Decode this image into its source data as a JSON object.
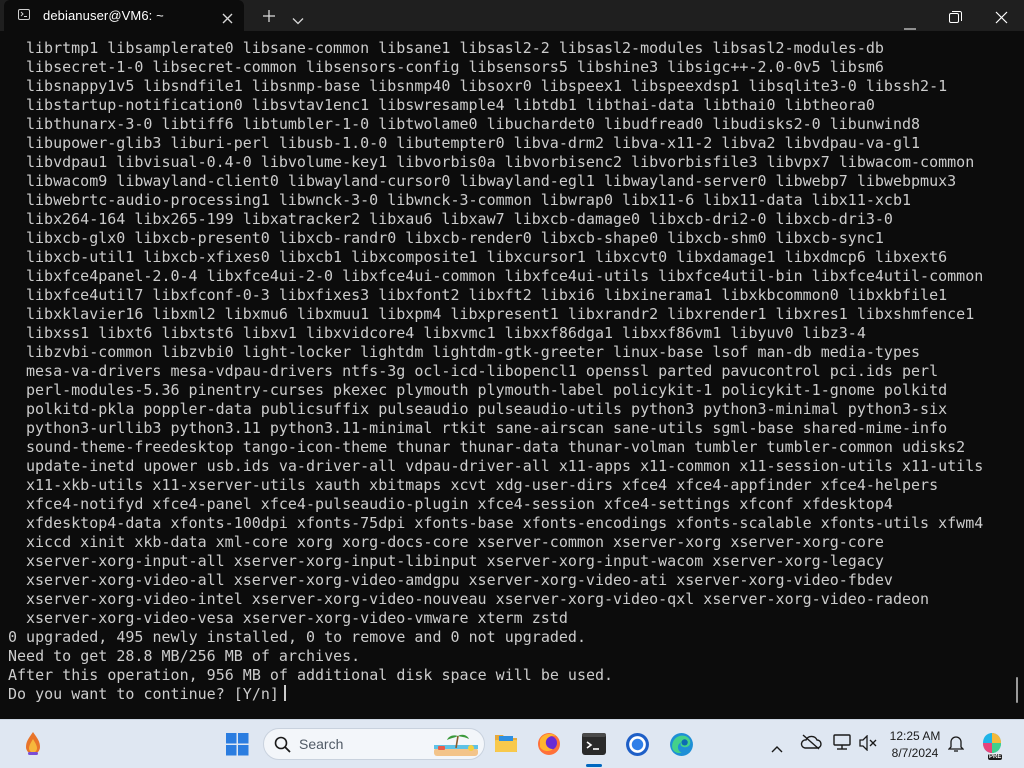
{
  "window": {
    "tab_title": "debianuser@VM6: ~",
    "tab_icon": "terminal-icon",
    "controls": [
      "close-icon",
      "plus-icon",
      "chevron-down-icon",
      "minimize-icon",
      "maximize-icon",
      "close-icon"
    ]
  },
  "terminal": {
    "package_lines": [
      "librtmp1 libsamplerate0 libsane-common libsane1 libsasl2-2 libsasl2-modules libsasl2-modules-db",
      "libsecret-1-0 libsecret-common libsensors-config libsensors5 libshine3 libsigc++-2.0-0v5 libsm6",
      "libsnappy1v5 libsndfile1 libsnmp-base libsnmp40 libsoxr0 libspeex1 libspeexdsp1 libsqlite3-0 libssh2-1",
      "libstartup-notification0 libsvtav1enc1 libswresample4 libtdb1 libthai-data libthai0 libtheora0",
      "libthunarx-3-0 libtiff6 libtumbler-1-0 libtwolame0 libuchardet0 libudfread0 libudisks2-0 libunwind8",
      "libupower-glib3 liburi-perl libusb-1.0-0 libutempter0 libva-drm2 libva-x11-2 libva2 libvdpau-va-gl1",
      "libvdpau1 libvisual-0.4-0 libvolume-key1 libvorbis0a libvorbisenc2 libvorbisfile3 libvpx7 libwacom-common",
      "libwacom9 libwayland-client0 libwayland-cursor0 libwayland-egl1 libwayland-server0 libwebp7 libwebpmux3",
      "libwebrtc-audio-processing1 libwnck-3-0 libwnck-3-common libwrap0 libx11-6 libx11-data libx11-xcb1",
      "libx264-164 libx265-199 libxatracker2 libxau6 libxaw7 libxcb-damage0 libxcb-dri2-0 libxcb-dri3-0",
      "libxcb-glx0 libxcb-present0 libxcb-randr0 libxcb-render0 libxcb-shape0 libxcb-shm0 libxcb-sync1",
      "libxcb-util1 libxcb-xfixes0 libxcb1 libxcomposite1 libxcursor1 libxcvt0 libxdamage1 libxdmcp6 libxext6",
      "libxfce4panel-2.0-4 libxfce4ui-2-0 libxfce4ui-common libxfce4ui-utils libxfce4util-bin libxfce4util-common",
      "libxfce4util7 libxfconf-0-3 libxfixes3 libxfont2 libxft2 libxi6 libxinerama1 libxkbcommon0 libxkbfile1",
      "libxklavier16 libxml2 libxmu6 libxmuu1 libxpm4 libxpresent1 libxrandr2 libxrender1 libxres1 libxshmfence1",
      "libxss1 libxt6 libxtst6 libxv1 libxvidcore4 libxvmc1 libxxf86dga1 libxxf86vm1 libyuv0 libz3-4",
      "libzvbi-common libzvbi0 light-locker lightdm lightdm-gtk-greeter linux-base lsof man-db media-types",
      "mesa-va-drivers mesa-vdpau-drivers ntfs-3g ocl-icd-libopencl1 openssl parted pavucontrol pci.ids perl",
      "perl-modules-5.36 pinentry-curses pkexec plymouth plymouth-label policykit-1 policykit-1-gnome polkitd",
      "polkitd-pkla poppler-data publicsuffix pulseaudio pulseaudio-utils python3 python3-minimal python3-six",
      "python3-urllib3 python3.11 python3.11-minimal rtkit sane-airscan sane-utils sgml-base shared-mime-info",
      "sound-theme-freedesktop tango-icon-theme thunar thunar-data thunar-volman tumbler tumbler-common udisks2",
      "update-inetd upower usb.ids va-driver-all vdpau-driver-all x11-apps x11-common x11-session-utils x11-utils",
      "x11-xkb-utils x11-xserver-utils xauth xbitmaps xcvt xdg-user-dirs xfce4 xfce4-appfinder xfce4-helpers",
      "xfce4-notifyd xfce4-panel xfce4-pulseaudio-plugin xfce4-session xfce4-settings xfconf xfdesktop4",
      "xfdesktop4-data xfonts-100dpi xfonts-75dpi xfonts-base xfonts-encodings xfonts-scalable xfonts-utils xfwm4",
      "xiccd xinit xkb-data xml-core xorg xorg-docs-core xserver-common xserver-xorg xserver-xorg-core",
      "xserver-xorg-input-all xserver-xorg-input-libinput xserver-xorg-input-wacom xserver-xorg-legacy",
      "xserver-xorg-video-all xserver-xorg-video-amdgpu xserver-xorg-video-ati xserver-xorg-video-fbdev",
      "xserver-xorg-video-intel xserver-xorg-video-nouveau xserver-xorg-video-qxl xserver-xorg-video-radeon",
      "xserver-xorg-video-vesa xserver-xorg-video-vmware xterm zstd"
    ],
    "summary_lines": [
      "0 upgraded, 495 newly installed, 0 to remove and 0 not upgraded.",
      "Need to get 28.8 MB/256 MB of archives.",
      "After this operation, 956 MB of additional disk space will be used."
    ],
    "prompt": "Do you want to continue? [Y/n] "
  },
  "taskbar": {
    "search_placeholder": "Search",
    "pinned_apps": [
      "file-explorer-icon",
      "firefox-icon",
      "terminal-icon",
      "chrome-icon",
      "edge-icon"
    ],
    "active_app": "terminal-icon",
    "tray": {
      "time": "12:25 AM",
      "date": "8/7/2024",
      "copilot_badge": "PRE"
    },
    "colors": {
      "active_indicator": "#0067c0",
      "taskbar_bg": "#dfe7f2",
      "terminal_bg": "#0c0c0c",
      "terminal_fg": "#cccccc"
    }
  }
}
